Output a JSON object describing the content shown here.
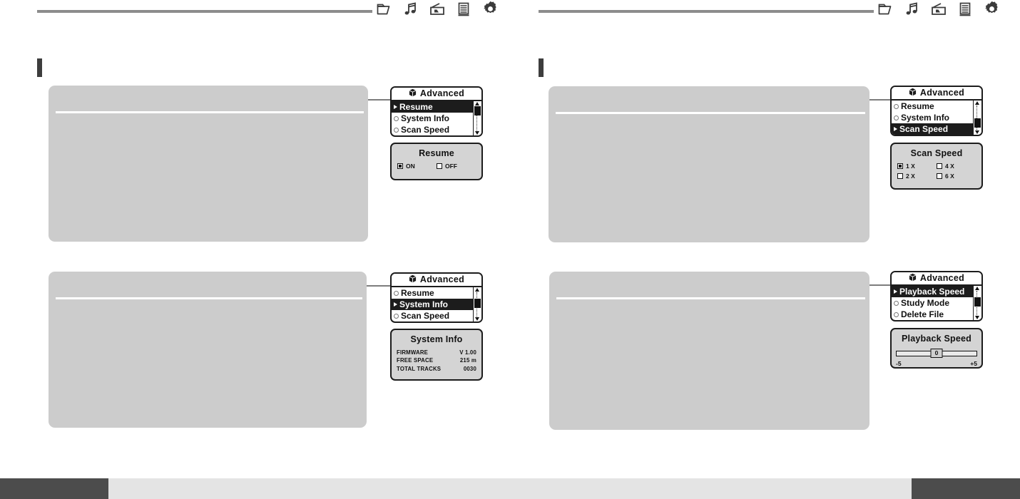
{
  "header": {
    "icons": [
      {
        "name": "folder-icon",
        "label": "Folder"
      },
      {
        "name": "music-note-icon",
        "label": "Music"
      },
      {
        "name": "radio-icon",
        "label": "Radio"
      },
      {
        "name": "list-icon",
        "label": "List"
      },
      {
        "name": "gear-icon",
        "label": "Settings"
      }
    ]
  },
  "menu_title": "Advanced",
  "menu_title_icon": "cube-icon",
  "panels": [
    {
      "id": "resume",
      "column": "left",
      "menu_items": [
        {
          "label": "Resume",
          "selected": true
        },
        {
          "label": "System Info",
          "selected": false
        },
        {
          "label": "Scan Speed",
          "selected": false
        }
      ],
      "scroll_thumb_pos": "top",
      "dialog": {
        "title": "Resume",
        "type": "options",
        "options": [
          {
            "label": "ON",
            "selected": true
          },
          {
            "label": "OFF",
            "selected": false
          }
        ]
      }
    },
    {
      "id": "system-info",
      "column": "left",
      "menu_items": [
        {
          "label": "Resume",
          "selected": false
        },
        {
          "label": "System Info",
          "selected": true
        },
        {
          "label": "Scan Speed",
          "selected": false
        }
      ],
      "scroll_thumb_pos": "middle",
      "dialog": {
        "title": "System Info",
        "type": "info",
        "rows": [
          {
            "label": "FIRMWARE",
            "value": "V 1.00"
          },
          {
            "label": "FREE SPACE",
            "value": "215 m"
          },
          {
            "label": "TOTAL TRACKS",
            "value": "0030"
          }
        ]
      }
    },
    {
      "id": "scan-speed",
      "column": "right",
      "menu_items": [
        {
          "label": "Resume",
          "selected": false
        },
        {
          "label": "System Info",
          "selected": false
        },
        {
          "label": "Scan Speed",
          "selected": true
        }
      ],
      "scroll_thumb_pos": "bottom",
      "dialog": {
        "title": "Scan Speed",
        "type": "options",
        "options": [
          {
            "label": "1 X",
            "selected": true
          },
          {
            "label": "4 X",
            "selected": false
          },
          {
            "label": "2 X",
            "selected": false
          },
          {
            "label": "6 X",
            "selected": false
          }
        ]
      }
    },
    {
      "id": "playback-speed",
      "column": "right",
      "menu_items": [
        {
          "label": "Playback Speed",
          "selected": true
        },
        {
          "label": "Study Mode",
          "selected": false
        },
        {
          "label": "Delete File",
          "selected": false
        }
      ],
      "scroll_thumb_pos": "middle",
      "dialog": {
        "title": "Playback Speed",
        "type": "slider",
        "slider": {
          "value": "0",
          "min_label": "-5",
          "max_label": "+5"
        }
      }
    }
  ]
}
